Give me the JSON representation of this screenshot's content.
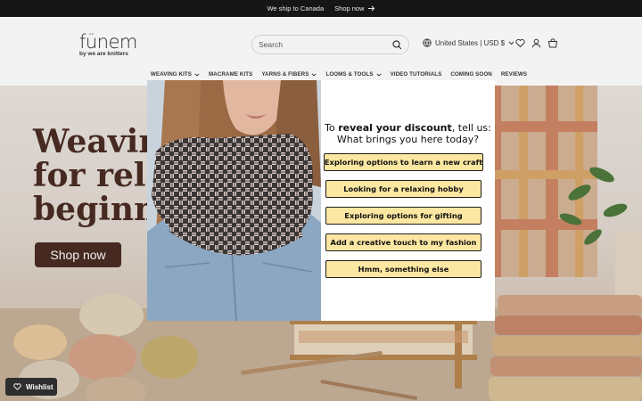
{
  "announcement": {
    "text": "We ship to Canada",
    "link": "Shop now"
  },
  "header": {
    "logo_word": "fünem",
    "logo_tagline": "by we are knitters",
    "search_placeholder": "Search",
    "locale": "United States | USD $"
  },
  "nav": {
    "items": [
      {
        "label": "WEAVING KITS",
        "dropdown": true
      },
      {
        "label": "MACRAME KITS",
        "dropdown": false
      },
      {
        "label": "YARNS & FIBERS",
        "dropdown": true
      },
      {
        "label": "LOOMS & TOOLS",
        "dropdown": true
      },
      {
        "label": "VIDEO TUTORIALS",
        "dropdown": false
      },
      {
        "label": "COMING SOON",
        "dropdown": false
      },
      {
        "label": "REVIEWS",
        "dropdown": false
      }
    ]
  },
  "hero": {
    "title_line1": "Weaving",
    "title_line2": "for relax",
    "title_line3": "beginni",
    "cta": "Shop now"
  },
  "wishlist": {
    "label": "Wishlist"
  },
  "modal": {
    "question_pre": "To ",
    "question_bold": "reveal your discount",
    "question_post": ", tell us:",
    "question_line2": "What brings you here today?",
    "options": [
      "Exploring options to learn a new craft",
      "Looking for a relaxing hobby",
      "Exploring options for gifting",
      "Add a creative touch to my fashion",
      "Hmm, something else"
    ],
    "button_color": "#fbe7a1"
  },
  "colors": {
    "brand_brown": "#4b2d24",
    "topbar": "#161616"
  }
}
